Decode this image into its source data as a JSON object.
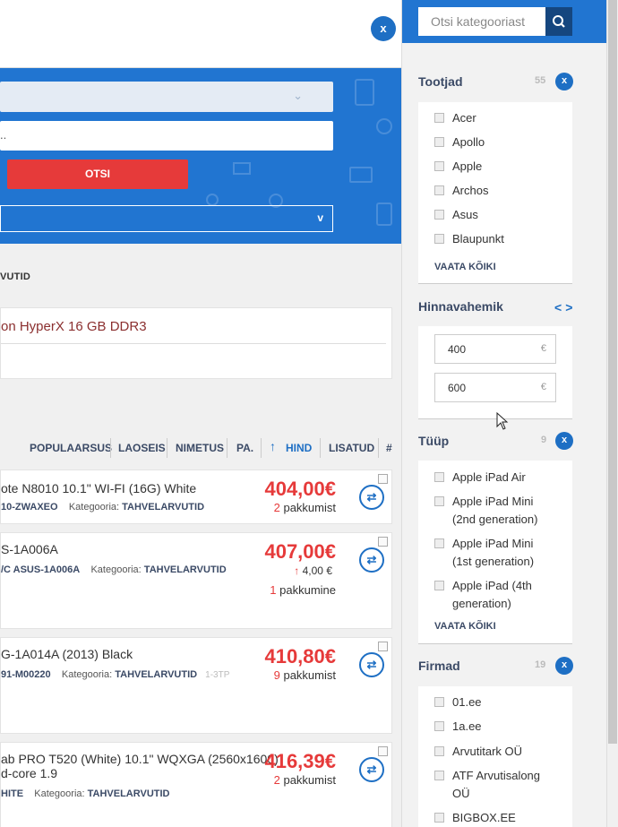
{
  "top_panel": {
    "close_label": "x"
  },
  "search": {
    "button_label": "OTSI",
    "text_value": "..",
    "dropdown_chevron": "chevron-down-icon",
    "category_chevron": "v"
  },
  "breadcrumb": "VUTID",
  "selected_chip": "on HyperX 16 GB DDR3",
  "sort": {
    "items": [
      "POPULAARSUS",
      "LAOSEIS",
      "NIMETUS",
      "PA.",
      "HIND",
      "LISATUD",
      "#"
    ],
    "active": "HIND",
    "arrow": "↑"
  },
  "products": [
    {
      "name": "ote N8010 10.1\" WI-FI (16G) White",
      "code": "10-ZWAXEO",
      "category_label": "Kategooria:",
      "category": "TAHVELARVUTID",
      "tag": "",
      "price": "404,00€",
      "offers_count": "2",
      "offers_word": "pakkumist",
      "trend_arrow": "",
      "trend_value": ""
    },
    {
      "name": "S-1A006A",
      "code": "/C ASUS-1A006A",
      "category_label": "Kategooria:",
      "category": "TAHVELARVUTID",
      "tag": "",
      "price": "407,00€",
      "offers_count": "1",
      "offers_word": "pakkumine",
      "trend_arrow": "↑",
      "trend_value": "4,00 €"
    },
    {
      "name": "G-1A014A (2013) Black",
      "code": "91-M00220",
      "category_label": "Kategooria:",
      "category": "TAHVELARVUTID",
      "tag": "1-3TP",
      "price": "410,80€",
      "offers_count": "9",
      "offers_word": "pakkumist",
      "trend_arrow": "",
      "trend_value": ""
    },
    {
      "name": "ab PRO T520 (White) 10.1\" WQXGA (2560x1600)",
      "name_line2": "d-core 1.9",
      "code": "HITE",
      "category_label": "Kategooria:",
      "category": "TAHVELARVUTID",
      "tag": "",
      "price": "416,39€",
      "offers_count": "2",
      "offers_word": "pakkumist",
      "trend_arrow": "",
      "trend_value": ""
    }
  ],
  "sidebar": {
    "search_placeholder": "Otsi kategooriast",
    "manufacturers": {
      "title": "Tootjad",
      "count": "55",
      "close": "x",
      "items": [
        "Acer",
        "Apollo",
        "Apple",
        "Archos",
        "Asus",
        "Blaupunkt"
      ],
      "see_all": "VAATA KÕIKI"
    },
    "price_range": {
      "title": "Hinnavahemik",
      "min": "400",
      "max": "600",
      "currency": "€",
      "prev": "<",
      "next": ">"
    },
    "type": {
      "title": "Tüüp",
      "count": "9",
      "close": "x",
      "items": [
        [
          "Apple iPad Air"
        ],
        [
          "Apple iPad Mini",
          "(2nd generation)"
        ],
        [
          "Apple iPad Mini",
          "(1st generation)"
        ],
        [
          "Apple iPad (4th",
          "generation)"
        ]
      ],
      "see_all": "VAATA KÕIKI"
    },
    "firms": {
      "title": "Firmad",
      "count": "19",
      "close": "x",
      "items": [
        [
          "01.ee"
        ],
        [
          "1a.ee"
        ],
        [
          "Arvutitark OÜ"
        ],
        [
          "ATF Arvutisalong",
          "OÜ"
        ],
        [
          "BIGBOX.EE"
        ]
      ]
    }
  },
  "colors": {
    "primary_blue": "#2175d1",
    "dark_blue": "#15467f",
    "price_red": "#e63a3a",
    "label_navy": "#3b4a66"
  }
}
